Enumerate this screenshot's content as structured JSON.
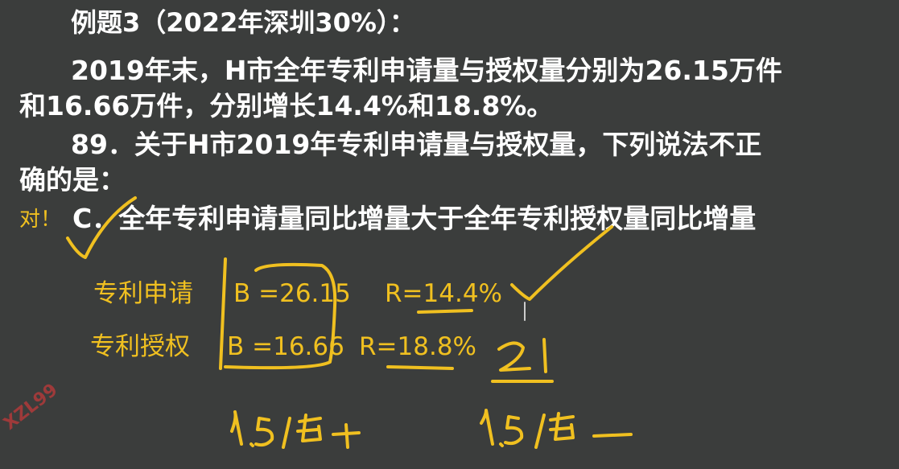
{
  "question": {
    "title": "例题3（2022年深圳30%）：",
    "stem_line1": "2019年末，H市全年专利申请量与授权量分别为26.15万件",
    "stem_line2": "和16.66万件，分别增长14.4%和18.8%。",
    "ask_line1": "89．关于H市2019年专利申请量与授权量，下列说法不正",
    "ask_line2": "确的是：",
    "option_c": "C．全年专利申请量同比增量大于全年专利授权量同比增量"
  },
  "annotation": {
    "correct_mark": "对！",
    "row1": {
      "label": "专利申请",
      "base": "B =26.15",
      "rate": "R=14.4%"
    },
    "row2": {
      "label": "专利授权",
      "base": "B =16.66",
      "rate": "R=18.8%"
    },
    "ink_color": "#f0c020",
    "hand_21": "21",
    "hand_left": "1.5倍+",
    "hand_right": "1.5倍 —"
  },
  "watermark": "XZL99",
  "colors": {
    "background": "#3b3d3c",
    "text": "#ffffff",
    "annotation": "#f0c020",
    "watermark": "#b03a3a"
  }
}
